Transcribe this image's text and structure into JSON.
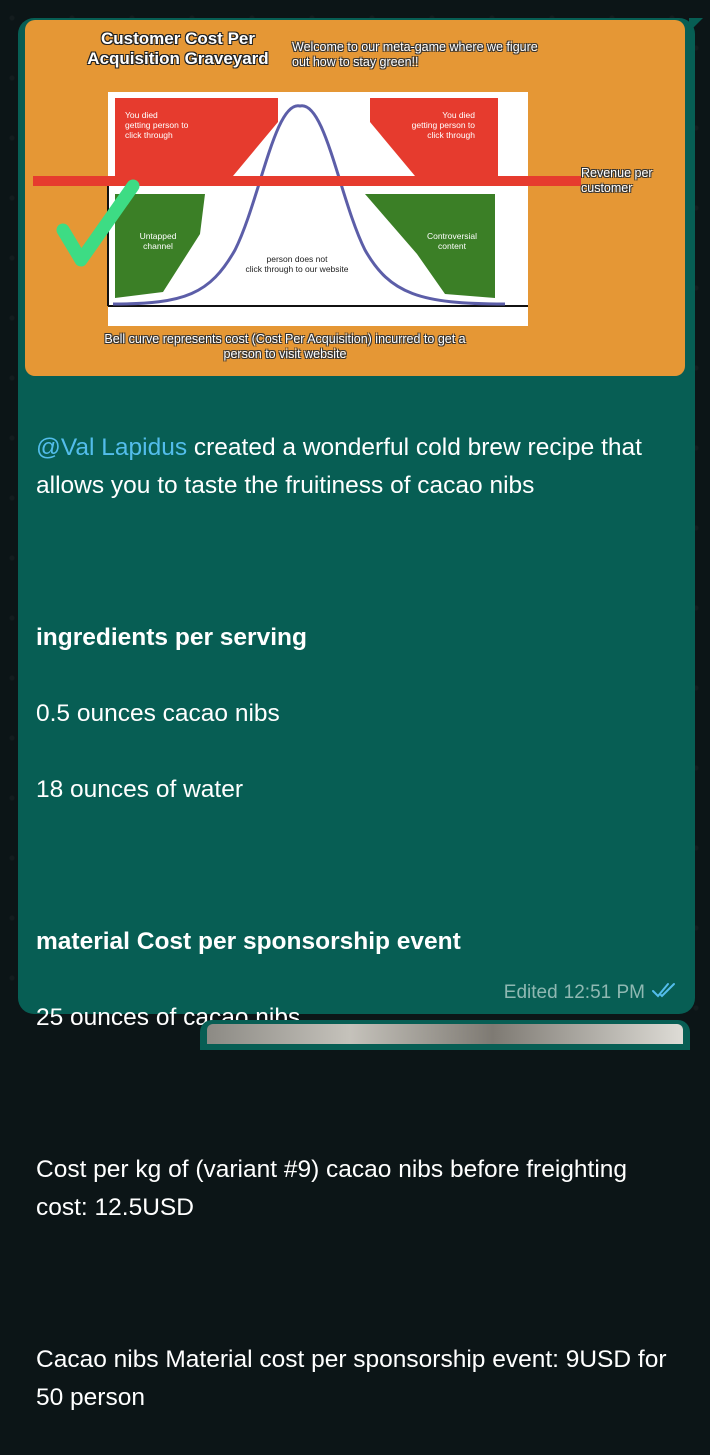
{
  "image": {
    "title": "Customer Cost Per Acquisition Graveyard",
    "welcome": "Welcome to our meta-game where we figure out how to stay green!!",
    "died_left": [
      "You died",
      "getting person to",
      "click through"
    ],
    "died_right": [
      "You died",
      "getting person to",
      "click through"
    ],
    "revenue": "Revenue per customer",
    "untapped": [
      "Untapped",
      "channel"
    ],
    "controversial": [
      "Controversial",
      "content"
    ],
    "center": [
      "person does not",
      "click through to our website"
    ],
    "note": "Bell curve represents cost (Cost Per Acquisition) incurred to get a person to visit website",
    "colors": {
      "red": "#e63b2e",
      "green": "#3b7f26",
      "orange": "#e59735",
      "curve": "#5c5ea8",
      "check": "#3ddc84"
    }
  },
  "message": {
    "mention": "@Val Lapidus",
    "intro": " created a wonderful cold brew recipe that allows you to taste the fruitiness of cacao nibs",
    "ingredients_heading": "ingredients per serving",
    "ingredient_1": "0.5 ounces cacao nibs",
    "ingredient_2": "18 ounces of water",
    "material_heading": "material Cost per sponsorship event",
    "material_1": "25 ounces of cacao nibs",
    "cost_per_kg": "Cost per kg of (variant #9) cacao nibs before freighting cost: 12.5USD",
    "material_cost": "Cacao nibs Material cost per sponsorship event: 9USD for 50 person"
  },
  "meta": {
    "edited": "Edited",
    "time": "12:51 PM",
    "status_icon": "double-check-icon",
    "status_color": "#53bdeb"
  }
}
